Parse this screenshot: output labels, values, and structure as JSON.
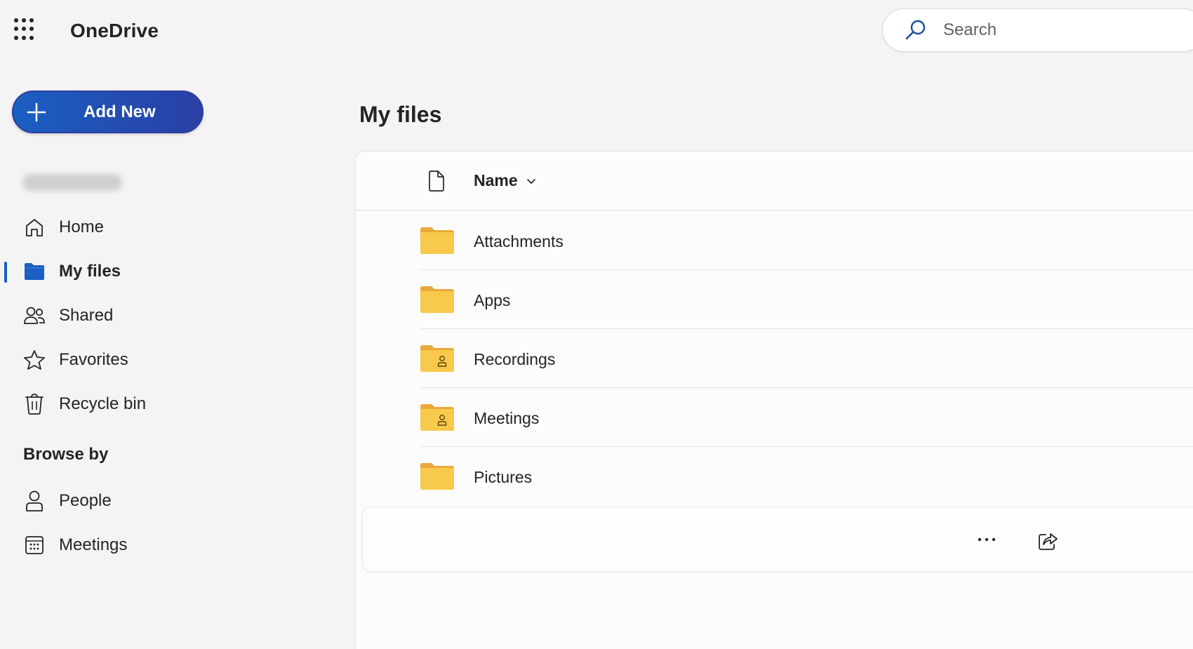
{
  "header": {
    "app_name": "OneDrive",
    "search_placeholder": "Search"
  },
  "sidebar": {
    "add_new_label": "Add New",
    "nav": [
      {
        "label": "Home",
        "icon": "home-icon"
      },
      {
        "label": "My files",
        "icon": "folder-icon",
        "active": true
      },
      {
        "label": "Shared",
        "icon": "people-icon"
      },
      {
        "label": "Favorites",
        "icon": "star-icon"
      },
      {
        "label": "Recycle bin",
        "icon": "trash-icon"
      }
    ],
    "browse_by_title": "Browse by",
    "browse": [
      {
        "label": "People",
        "icon": "person-icon"
      },
      {
        "label": "Meetings",
        "icon": "calendar-icon"
      }
    ]
  },
  "main": {
    "title": "My files",
    "column_name": "Name",
    "files": [
      {
        "name": "Attachments",
        "type": "folder"
      },
      {
        "name": "Apps",
        "type": "folder"
      },
      {
        "name": "Recordings",
        "type": "shared-folder"
      },
      {
        "name": "Meetings",
        "type": "shared-folder"
      },
      {
        "name": "Pictures",
        "type": "folder"
      }
    ]
  },
  "colors": {
    "accent": "#1a5fc2",
    "accent_end": "#2a3fa5",
    "folder_yellow": "#f8c94a",
    "background": "#f5f4f4"
  }
}
